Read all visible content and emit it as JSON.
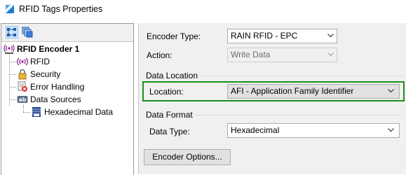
{
  "window": {
    "title": "RFID Tags Properties"
  },
  "tree": {
    "root_label": "RFID Encoder 1",
    "items": [
      {
        "label": "RFID",
        "icon": "rfid-signal-icon"
      },
      {
        "label": "Security",
        "icon": "lock-icon"
      },
      {
        "label": "Error Handling",
        "icon": "error-handling-icon"
      },
      {
        "label": "Data Sources",
        "icon": "data-sources-icon"
      }
    ],
    "child_label": "Hexadecimal Data"
  },
  "form": {
    "encoder_type_label": "Encoder Type:",
    "encoder_type_value": "RAIN RFID - EPC",
    "action_label": "Action:",
    "action_value": "Write Data",
    "data_location_title": "Data Location",
    "location_label": "Location:",
    "location_value": "AFI - Application Family Identifier",
    "data_format_title": "Data Format",
    "data_type_label": "Data Type:",
    "data_type_value": "Hexadecimal",
    "encoder_options_label": "Encoder Options..."
  },
  "colors": {
    "highlight": "#1a8f1a",
    "selection": "#cce4f7",
    "panel_bg": "#f0f0f0"
  }
}
